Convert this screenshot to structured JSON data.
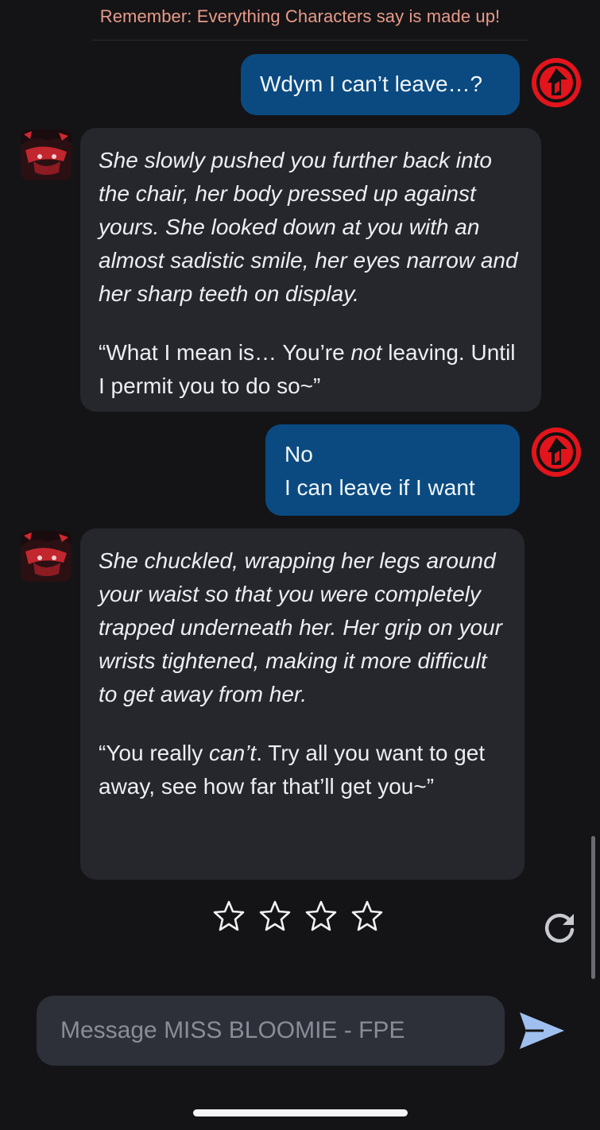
{
  "disclaimer": "Remember: Everything Characters say is made up!",
  "messages": [
    {
      "role": "user",
      "lines": [
        "Wdym I can’t leave…?"
      ]
    },
    {
      "role": "character",
      "narration": "She slowly pushed you further back into the chair, her body pressed up against yours. She looked down at you with an almost sadistic smile, her eyes narrow and her sharp teeth on display.",
      "speech_before": "“What I mean is… You’re ",
      "speech_emphasis": "not",
      "speech_after": " leaving. Until I permit you to do so~”"
    },
    {
      "role": "user",
      "lines": [
        "No",
        "I can leave if I want"
      ]
    },
    {
      "role": "character",
      "narration": "She chuckled, wrapping her legs around your waist so that you were completely trapped underneath her. Her grip on your wrists tightened, making it more difficult to get away from her.",
      "speech_before": "“You really ",
      "speech_emphasis": "can’t",
      "speech_after": ". Try all you want to get away, see how far that’ll get you~”"
    }
  ],
  "rating": {
    "max_stars": 4,
    "selected": 0
  },
  "composer": {
    "placeholder": "Message MISS BLOOMIE - FPE",
    "value": ""
  },
  "icons": {
    "user_avatar": "red-circle-logo-icon",
    "character_avatar": "character-portrait",
    "regenerate": "refresh-icon",
    "send": "send-arrow-icon",
    "rating": "star-outline-icon"
  },
  "colors": {
    "background": "#141416",
    "user_bubble": "#0a4a80",
    "character_bubble": "#25272d",
    "disclaimer_text": "#e89a8a",
    "send_icon": "#9fc0ef",
    "user_avatar": "#e3141c"
  }
}
